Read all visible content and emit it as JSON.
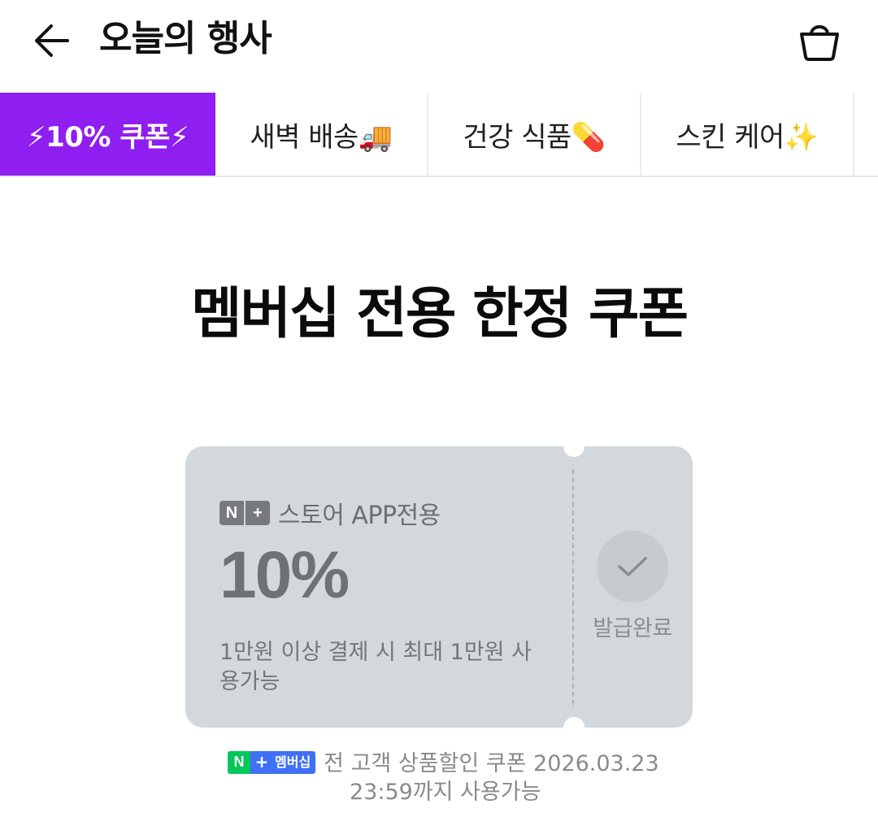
{
  "header": {
    "title": "오늘의 행사",
    "back_icon": "arrow-left-icon",
    "cart_icon": "shopping-bag-icon"
  },
  "tabs": [
    {
      "label": "⚡10% 쿠폰⚡",
      "active": true
    },
    {
      "label": "새벽 배송🚚",
      "active": false
    },
    {
      "label": "건강 식품💊",
      "active": false
    },
    {
      "label": "스킨 케어✨",
      "active": false
    }
  ],
  "headline": "멤버십 전용 한정 쿠폰",
  "coupon": {
    "badge_n": "N",
    "badge_plus": "+",
    "brand_text": "스토어 APP전용",
    "discount": "10%",
    "desc": "1만원 이상 결제 시 최대 1만원 사용가능",
    "status_label": "발급완료",
    "status_icon": "check-icon"
  },
  "footer_note": {
    "badge_n": "N",
    "badge_plus": "+",
    "badge_text": "멤버십",
    "line1": "전 고객 상품할인 쿠폰 2026.03.23",
    "line2": "23:59까지 사용가능"
  },
  "colors": {
    "accent_purple": "#8f1ff0",
    "coupon_bg": "#d3d8dc",
    "naver_green": "#03c75a",
    "membership_blue": "#3f70f5"
  }
}
